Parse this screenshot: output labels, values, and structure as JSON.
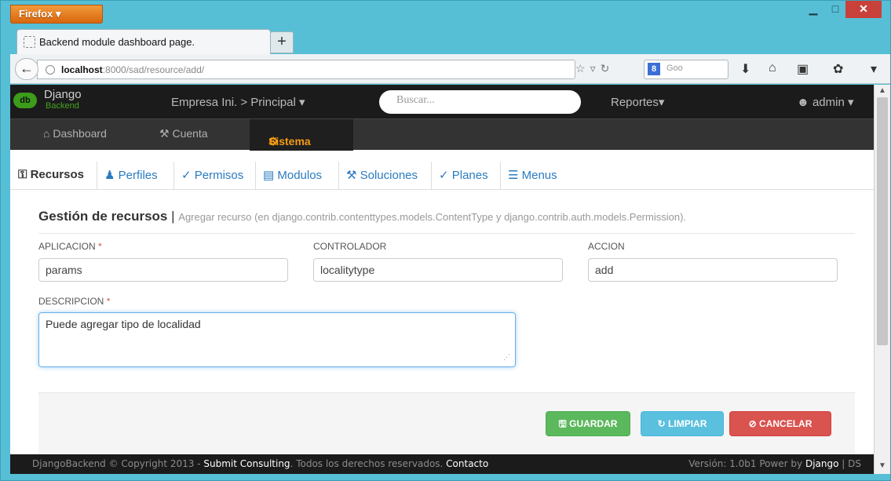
{
  "browser": {
    "menu_label": "Firefox ▾",
    "tab_title": "Backend module dashboard page.",
    "new_tab": "+",
    "url_host": "localhost",
    "url_path": ":8000/sad/resource/add/",
    "search_engine_letter": "8",
    "search_placeholder": "Goo",
    "window_controls": {
      "minimize": "▁",
      "maximize": "□",
      "close": "✕"
    }
  },
  "app": {
    "logo_text": "db",
    "brand_title": "Django",
    "brand_subtitle": "Backend",
    "company_menu": "Empresa Ini. > Principal ▾",
    "search_placeholder": "Buscar...",
    "reports_menu": "Reportes▾",
    "user_menu": "admin ▾"
  },
  "sections": [
    {
      "icon": "home-icon",
      "glyph": "🏠",
      "label": "Dashboard"
    },
    {
      "icon": "wrench-icon",
      "glyph": "🔧",
      "label": "Cuenta"
    },
    {
      "icon": "gears-icon",
      "glyph": "⚙",
      "label": "Sistema",
      "active": true
    }
  ],
  "subnav": [
    {
      "label": "Recursos",
      "glyph": "🔒",
      "active": true
    },
    {
      "label": "Perfiles",
      "glyph": "👥"
    },
    {
      "label": "Permisos",
      "glyph": "✎"
    },
    {
      "label": "Modulos",
      "glyph": "⊟"
    },
    {
      "label": "Soluciones",
      "glyph": "🔧"
    },
    {
      "label": "Planes",
      "glyph": "✎"
    },
    {
      "label": "Menus",
      "glyph": "☰"
    }
  ],
  "form": {
    "title": "Gestión de recursos",
    "separator": "|",
    "subtitle": "Agregar recurso (en django.contrib.contenttypes.models.ContentType y django.contrib.auth.models.Permission).",
    "required_mark": "*",
    "fields": {
      "aplicacion": {
        "label": "APLICACION",
        "value": "params"
      },
      "controlador": {
        "label": "CONTROLADOR",
        "value": "localitytype"
      },
      "accion": {
        "label": "ACCION",
        "value": "add"
      },
      "descripcion": {
        "label": "DESCRIPCION",
        "value": "Puede agregar tipo de localidad"
      }
    },
    "buttons": {
      "save": "🖫 GUARDAR",
      "clear": "↻ LIMPIAR",
      "cancel": "⊘ CANCELAR"
    }
  },
  "footer": {
    "brand": "DjangoBackend © Copyright 2013 - ",
    "company": "Submit Consulting",
    "rights": ". Todos los derechos reservados. ",
    "contact": "Contacto",
    "version": "Versión: 1.0b1 Power by ",
    "powered": "Django",
    "suffix": " | DS"
  },
  "colors": {
    "accent": "#f39c12",
    "brand_green": "#45a41e",
    "link": "#2a7bc0"
  }
}
